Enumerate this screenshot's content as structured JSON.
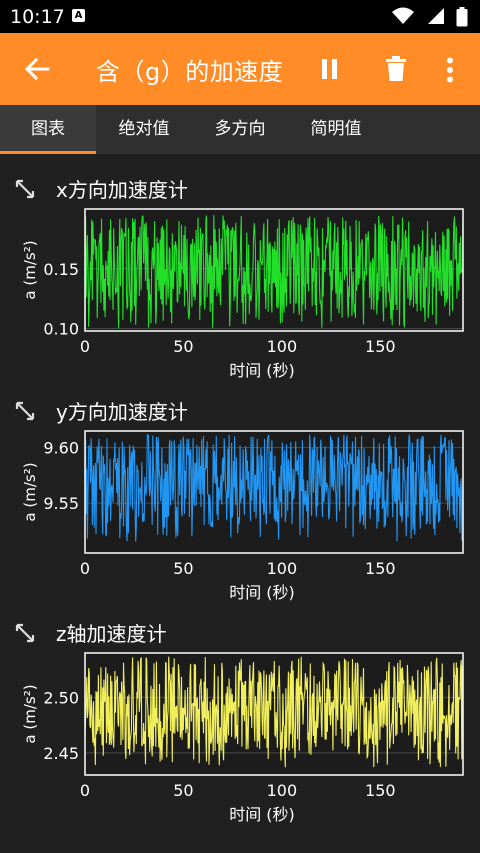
{
  "status_bar": {
    "time": "10:17",
    "notification_icon": "A",
    "icons": [
      "wifi-icon",
      "signal-icon",
      "battery-icon"
    ]
  },
  "app_bar": {
    "title": "含（g）的加速度",
    "actions": [
      "back-arrow-icon",
      "pause-icon",
      "trash-icon",
      "more-vert-icon"
    ],
    "color": "#ff8c26"
  },
  "tabs": [
    {
      "label": "图表",
      "active": true
    },
    {
      "label": "绝对值",
      "active": false
    },
    {
      "label": "多方向",
      "active": false
    },
    {
      "label": "简明值",
      "active": false
    }
  ],
  "charts": {
    "x": {
      "title": "x方向加速度计"
    },
    "y": {
      "title": "y方向加速度计"
    },
    "z": {
      "title": "z轴加速度计"
    }
  },
  "chart_data": [
    {
      "type": "line",
      "title": "x方向加速度计",
      "xlabel": "时间 (秒)",
      "ylabel": "a (m/s²)",
      "xlim": [
        0,
        192
      ],
      "ylim": [
        0.098,
        0.2
      ],
      "xticks": [
        0,
        50,
        100,
        150
      ],
      "yticks": [
        0.1,
        0.15
      ],
      "ytick_labels": [
        "0.10",
        "0.15"
      ],
      "color": "#22e02a",
      "series": [
        {
          "band_low": 0.1,
          "band_high": 0.195,
          "center": 0.145
        }
      ]
    },
    {
      "type": "line",
      "title": "y方向加速度计",
      "xlabel": "时间 (秒)",
      "ylabel": "a (m/s²)",
      "xlim": [
        0,
        192
      ],
      "ylim": [
        9.505,
        9.615
      ],
      "xticks": [
        0,
        50,
        100,
        150
      ],
      "yticks": [
        9.55,
        9.6
      ],
      "ytick_labels": [
        "9.55",
        "9.60"
      ],
      "color": "#2196f3",
      "series": [
        {
          "band_low": 9.515,
          "band_high": 9.612,
          "center": 9.565
        }
      ]
    },
    {
      "type": "line",
      "title": "z轴加速度计",
      "xlabel": "时间 (秒)",
      "ylabel": "a (m/s²)",
      "xlim": [
        0,
        192
      ],
      "ylim": [
        2.43,
        2.54
      ],
      "xticks": [
        0,
        50,
        100,
        150
      ],
      "yticks": [
        2.45,
        2.5
      ],
      "ytick_labels": [
        "2.45",
        "2.50"
      ],
      "color": "#f0ee5a",
      "series": [
        {
          "band_low": 2.437,
          "band_high": 2.537,
          "center": 2.49
        }
      ]
    }
  ]
}
